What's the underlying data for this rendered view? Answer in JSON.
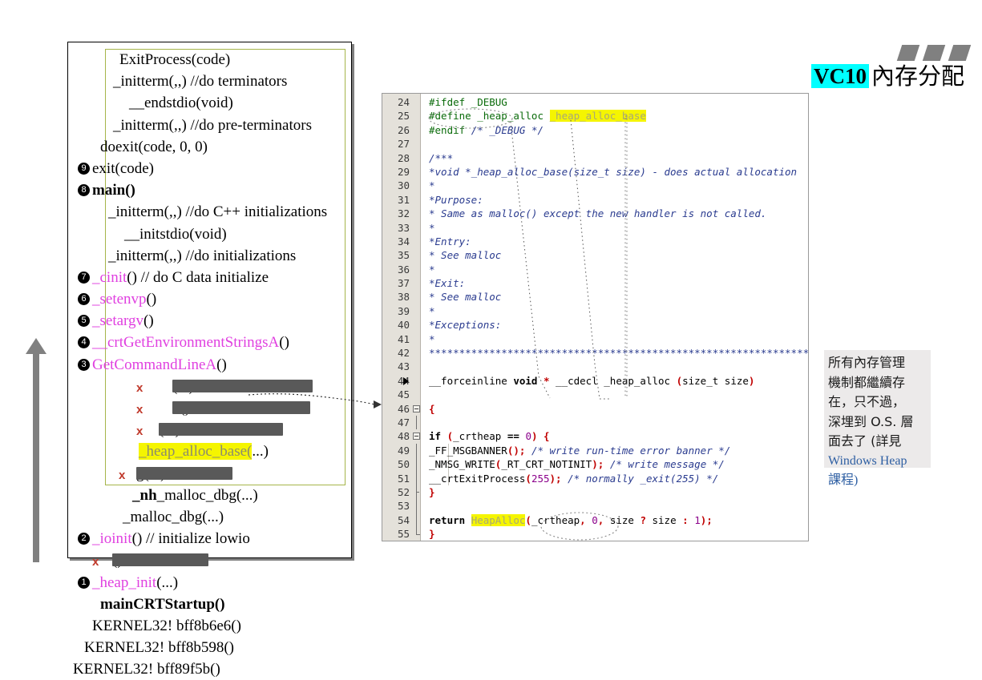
{
  "slide": {
    "title_badge": "VC10",
    "title_text": "內存分配",
    "deco_name": "three-slanted-bars"
  },
  "call_stack": {
    "panel_name": "call-stack-trace",
    "lines": [
      {
        "indent": 64,
        "badge": null,
        "x": false,
        "text": "ExitProcess(code)"
      },
      {
        "indent": 56,
        "badge": null,
        "x": false,
        "text": "_initterm(,,)    //do terminators"
      },
      {
        "indent": 76,
        "badge": null,
        "x": false,
        "text": "__endstdio(void)"
      },
      {
        "indent": 56,
        "badge": null,
        "x": false,
        "text": "_initterm(,,)    //do pre-terminators"
      },
      {
        "indent": 40,
        "badge": null,
        "x": false,
        "text": "doexit(code, 0, 0)"
      },
      {
        "indent": 30,
        "badge": "9",
        "x": false,
        "text": "exit(code)"
      },
      {
        "indent": 30,
        "badge": "8",
        "x": false,
        "text": "main()",
        "bold": true
      },
      {
        "indent": 50,
        "badge": null,
        "x": false,
        "text": "_initterm(,,)   //do C++ initializations"
      },
      {
        "indent": 70,
        "badge": null,
        "x": false,
        "text": "__initstdio(void)"
      },
      {
        "indent": 50,
        "badge": null,
        "x": false,
        "text": "_initterm(,,)   //do initializations"
      },
      {
        "indent": 30,
        "badge": "7",
        "x": false,
        "magenta": "_cinit",
        "text": "()   // do C data initialize"
      },
      {
        "indent": 30,
        "badge": "6",
        "x": false,
        "magenta": "_setenvp",
        "text": "()"
      },
      {
        "indent": 30,
        "badge": "5",
        "x": false,
        "magenta": "_setargv",
        "text": "()"
      },
      {
        "indent": 30,
        "badge": "4",
        "x": false,
        "magenta": "__crtGetEnvironmentStringsA",
        "text": "()"
      },
      {
        "indent": 30,
        "badge": "3",
        "x": false,
        "magenta": "GetCommandLineA",
        "text": "()"
      },
      {
        "indent": 130,
        "badge": null,
        "x": 85,
        "redact": [
          130,
          175
        ],
        "text": "(...)"
      },
      {
        "indent": 130,
        "badge": null,
        "x": 85,
        "redact": [
          130,
          172
        ],
        "text": "n()"
      },
      {
        "indent": 113,
        "badge": null,
        "x": 85,
        "redact": [
          113,
          155
        ],
        "text": "(...)"
      },
      {
        "indent": 88,
        "badge": null,
        "x": false,
        "highlight": "_heap_alloc_base(",
        "text": "...)"
      },
      {
        "indent": 85,
        "badge": null,
        "x": 63,
        "redact": [
          85,
          120
        ],
        "text": "g(...)"
      },
      {
        "indent": 80,
        "badge": null,
        "x": false,
        "bold_part": "_nh",
        "text": "_malloc_dbg(...)"
      },
      {
        "indent": 68,
        "badge": null,
        "x": false,
        "text": "_malloc_dbg(...)"
      },
      {
        "indent": 30,
        "badge": "2",
        "x": false,
        "magenta": "_ioinit",
        "text": "()  // initialize lowio"
      },
      {
        "indent": 55,
        "badge": null,
        "x": 30,
        "redact": [
          55,
          120
        ],
        "text": "()"
      },
      {
        "indent": 30,
        "badge": "1",
        "x": false,
        "magenta": "_heap_init",
        "text": "(...)"
      },
      {
        "indent": 40,
        "badge": null,
        "x": false,
        "text": "mainCRTStartup()",
        "bold": true
      },
      {
        "indent": 30,
        "badge": null,
        "x": false,
        "text": "KERNEL32! bff8b6e6()"
      },
      {
        "indent": 20,
        "badge": null,
        "x": false,
        "text": "KERNEL32! bff8b598()"
      },
      {
        "indent": 6,
        "badge": null,
        "x": false,
        "text": "KERNEL32! bff89f5b()"
      }
    ]
  },
  "code_editor": {
    "panel_name": "source-code-viewer",
    "first_line": 24,
    "marker_line": 44,
    "fold_lines": [
      46,
      48
    ],
    "lines": [
      {
        "n": 24,
        "segs": [
          {
            "t": "#ifdef _DEBUG",
            "c": "pp"
          }
        ]
      },
      {
        "n": 25,
        "segs": [
          {
            "t": "#define _heap_alloc ",
            "c": "pp"
          },
          {
            "t": "_heap_alloc_base",
            "c": "hl-fade"
          }
        ]
      },
      {
        "n": 26,
        "segs": [
          {
            "t": "#endif  ",
            "c": "pp"
          },
          {
            "t": "/* _DEBUG */",
            "c": "cm"
          }
        ]
      },
      {
        "n": 27,
        "segs": []
      },
      {
        "n": 28,
        "segs": [
          {
            "t": "/***",
            "c": "cm"
          }
        ]
      },
      {
        "n": 29,
        "segs": [
          {
            "t": "*void *_heap_alloc_base(size_t size) - does actual allocation",
            "c": "cm"
          }
        ]
      },
      {
        "n": 30,
        "segs": [
          {
            "t": "*",
            "c": "cm"
          }
        ]
      },
      {
        "n": 31,
        "segs": [
          {
            "t": "*Purpose:",
            "c": "cm"
          }
        ]
      },
      {
        "n": 32,
        "segs": [
          {
            "t": "*        Same as malloc() except the new handler is not called.",
            "c": "cm"
          }
        ]
      },
      {
        "n": 33,
        "segs": [
          {
            "t": "*",
            "c": "cm"
          }
        ]
      },
      {
        "n": 34,
        "segs": [
          {
            "t": "*Entry:",
            "c": "cm"
          }
        ]
      },
      {
        "n": 35,
        "segs": [
          {
            "t": "*        See malloc",
            "c": "cm"
          }
        ]
      },
      {
        "n": 36,
        "segs": [
          {
            "t": "*",
            "c": "cm"
          }
        ]
      },
      {
        "n": 37,
        "segs": [
          {
            "t": "*Exit:",
            "c": "cm"
          }
        ]
      },
      {
        "n": 38,
        "segs": [
          {
            "t": "*        See malloc",
            "c": "cm"
          }
        ]
      },
      {
        "n": 39,
        "segs": [
          {
            "t": "*",
            "c": "cm"
          }
        ]
      },
      {
        "n": 40,
        "segs": [
          {
            "t": "*Exceptions:",
            "c": "cm"
          }
        ]
      },
      {
        "n": 41,
        "segs": [
          {
            "t": "*",
            "c": "cm"
          }
        ]
      },
      {
        "n": 42,
        "segs": [
          {
            "t": "*****************************************************************",
            "c": "cm"
          }
        ]
      },
      {
        "n": 43,
        "segs": []
      },
      {
        "n": 44,
        "segs": [
          {
            "t": "__forceinline ",
            "c": ""
          },
          {
            "t": "void",
            "c": "kw"
          },
          {
            "t": " ",
            "c": ""
          },
          {
            "t": "*",
            "c": "punc"
          },
          {
            "t": " __cdecl _heap_alloc ",
            "c": ""
          },
          {
            "t": "(",
            "c": "punc"
          },
          {
            "t": "size_t size",
            "c": ""
          },
          {
            "t": ")",
            "c": "punc"
          }
        ]
      },
      {
        "n": 45,
        "segs": []
      },
      {
        "n": 46,
        "segs": [
          {
            "t": "{",
            "c": "punc"
          }
        ]
      },
      {
        "n": 47,
        "segs": []
      },
      {
        "n": 48,
        "segs": [
          {
            "t": "    ",
            "c": ""
          },
          {
            "t": "if",
            "c": "kw"
          },
          {
            "t": " ",
            "c": ""
          },
          {
            "t": "(",
            "c": "punc"
          },
          {
            "t": "_crtheap ",
            "c": ""
          },
          {
            "t": "==",
            "c": "kw"
          },
          {
            "t": " ",
            "c": ""
          },
          {
            "t": "0",
            "c": "num"
          },
          {
            "t": ")",
            "c": "punc"
          },
          {
            "t": " ",
            "c": ""
          },
          {
            "t": "{",
            "c": "punc"
          }
        ]
      },
      {
        "n": 49,
        "segs": [
          {
            "t": "        _FF_MSGBANNER",
            "c": ""
          },
          {
            "t": "();",
            "c": "punc"
          },
          {
            "t": "     ",
            "c": ""
          },
          {
            "t": "/* write run-time error banner */",
            "c": "cm"
          }
        ]
      },
      {
        "n": 50,
        "segs": [
          {
            "t": "        _NMSG_WRITE",
            "c": ""
          },
          {
            "t": "(",
            "c": "punc"
          },
          {
            "t": "_RT_CRT_NOTINIT",
            "c": ""
          },
          {
            "t": ");",
            "c": "punc"
          },
          {
            "t": "  ",
            "c": ""
          },
          {
            "t": "/* write message */",
            "c": "cm"
          }
        ]
      },
      {
        "n": 51,
        "segs": [
          {
            "t": "        __crtExitProcess",
            "c": ""
          },
          {
            "t": "(",
            "c": "punc"
          },
          {
            "t": "255",
            "c": "num"
          },
          {
            "t": ");",
            "c": "punc"
          },
          {
            "t": "  ",
            "c": ""
          },
          {
            "t": "/* normally _exit(255) */",
            "c": "cm"
          }
        ]
      },
      {
        "n": 52,
        "segs": [
          {
            "t": "    ",
            "c": ""
          },
          {
            "t": "}",
            "c": "punc"
          }
        ]
      },
      {
        "n": 53,
        "segs": []
      },
      {
        "n": 54,
        "segs": [
          {
            "t": "    ",
            "c": ""
          },
          {
            "t": "return",
            "c": "kw"
          },
          {
            "t": " ",
            "c": ""
          },
          {
            "t": "HeapAlloc",
            "c": "hl-fade"
          },
          {
            "t": "(",
            "c": "punc"
          },
          {
            "t": "_crtheap",
            "c": ""
          },
          {
            "t": ",",
            "c": "punc"
          },
          {
            "t": " ",
            "c": ""
          },
          {
            "t": "0",
            "c": "num"
          },
          {
            "t": ",",
            "c": "punc"
          },
          {
            "t": " size ",
            "c": ""
          },
          {
            "t": "?",
            "c": "punc"
          },
          {
            "t": " size ",
            "c": ""
          },
          {
            "t": ":",
            "c": "punc"
          },
          {
            "t": " ",
            "c": ""
          },
          {
            "t": "1",
            "c": "num"
          },
          {
            "t": ");",
            "c": "punc"
          }
        ]
      },
      {
        "n": 55,
        "segs": [
          {
            "t": "}",
            "c": "punc"
          }
        ]
      }
    ]
  },
  "note": {
    "name": "side-note",
    "lines": [
      {
        "text": "所有內存管理",
        "style": "plain"
      },
      {
        "text": "機制都繼續存",
        "style": "plain"
      },
      {
        "text": "在，只不過，",
        "style": "plain"
      },
      {
        "text": "深埋到 O.S. 層",
        "style": "plain"
      },
      {
        "text": "面去了 (詳見",
        "style": "plain"
      },
      {
        "text": "Windows Heap",
        "style": "link"
      },
      {
        "text": "課程)",
        "style": "link-close"
      }
    ]
  },
  "flow_arrow": {
    "name": "stack-growth-arrow",
    "direction": "up",
    "color": "#808080"
  }
}
